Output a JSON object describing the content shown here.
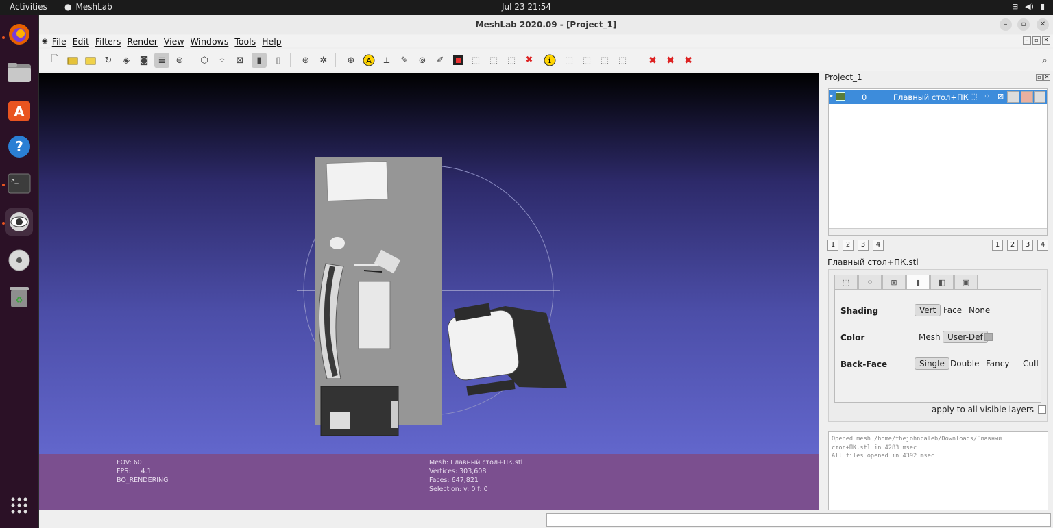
{
  "topbar": {
    "activities": "Activities",
    "app_name": "MeshLab",
    "clock": "Jul 23  21:54"
  },
  "dock": {
    "items": [
      {
        "name": "firefox"
      },
      {
        "name": "files"
      },
      {
        "name": "software"
      },
      {
        "name": "help"
      },
      {
        "name": "terminal"
      },
      {
        "name": "meshlab"
      },
      {
        "name": "dvd"
      },
      {
        "name": "trash"
      },
      {
        "name": "show-apps"
      }
    ]
  },
  "window": {
    "title": "MeshLab 2020.09 - [Project_1]"
  },
  "menu": {
    "items": [
      "File",
      "Edit",
      "Filters",
      "Render",
      "View",
      "Windows",
      "Tools",
      "Help"
    ]
  },
  "viewport": {
    "left_info": [
      "FOV: 60",
      "FPS:     4.1",
      "BO_RENDERING"
    ],
    "right_info": [
      "Mesh: Главный стол+ПК.stl",
      "Vertices: 303,608",
      "Faces: 647,821",
      "Selection: v: 0 f: 0"
    ]
  },
  "project": {
    "title": "Project_1",
    "layer": {
      "index": "0",
      "name": "Главный стол+ПК"
    },
    "pages_left": [
      "1",
      "2",
      "3",
      "4"
    ],
    "pages_right": [
      "1",
      "2",
      "3",
      "4"
    ],
    "mesh_file": "Главный стол+ПК.stl"
  },
  "render": {
    "shading": {
      "label": "Shading",
      "options": [
        "Vert",
        "Face",
        "None"
      ],
      "selected": "Vert"
    },
    "color": {
      "label": "Color",
      "options": [
        "Mesh",
        "User-Def"
      ],
      "selected": "User-Def"
    },
    "backface": {
      "label": "Back-Face",
      "options": [
        "Single",
        "Double",
        "Fancy",
        "Cull"
      ],
      "selected": "Single"
    },
    "apply_label": "apply to all visible layers"
  },
  "log": {
    "lines": [
      "Opened mesh /home/thejohncaleb/Downloads/Главный",
      "стол+ПК.stl in 4283 msec",
      "All files opened in 4392 msec"
    ]
  },
  "colors": {
    "selection_blue": "#3d8cdb",
    "info_bar": "#7b4f8f",
    "dock_bg": "#2b1126",
    "accent_orange": "#e95420"
  }
}
